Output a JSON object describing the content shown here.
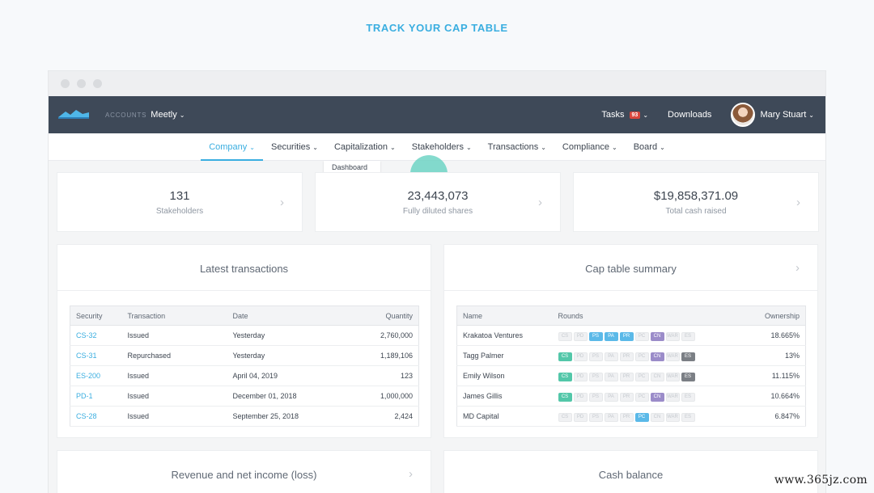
{
  "headline": "TRACK YOUR CAP TABLE",
  "topbar": {
    "accounts_label": "ACCOUNTS",
    "company": "Meetly",
    "tasks_label": "Tasks",
    "tasks_count": "93",
    "downloads": "Downloads",
    "user": "Mary Stuart"
  },
  "subnav": {
    "items": [
      "Company",
      "Securities",
      "Capitalization",
      "Stakeholders",
      "Transactions",
      "Compliance",
      "Board"
    ],
    "active": "Company",
    "dropdown_peek": "Dashboard"
  },
  "stats": [
    {
      "value": "131",
      "label": "Stakeholders"
    },
    {
      "value": "23,443,073",
      "label": "Fully diluted shares"
    },
    {
      "value": "$19,858,371.09",
      "label": "Total cash raised"
    }
  ],
  "latest": {
    "title": "Latest transactions",
    "columns": [
      "Security",
      "Transaction",
      "Date",
      "Quantity"
    ],
    "rows": [
      [
        "CS-32",
        "Issued",
        "Yesterday",
        "2,760,000"
      ],
      [
        "CS-31",
        "Repurchased",
        "Yesterday",
        "1,189,106"
      ],
      [
        "ES-200",
        "Issued",
        "April 04, 2019",
        "123"
      ],
      [
        "PD-1",
        "Issued",
        "December 01, 2018",
        "1,000,000"
      ],
      [
        "CS-28",
        "Issued",
        "September 25, 2018",
        "2,424"
      ]
    ]
  },
  "captable": {
    "title": "Cap table summary",
    "columns": [
      "Name",
      "Rounds",
      "Ownership"
    ],
    "round_codes": [
      "CS",
      "PD",
      "PS",
      "PA",
      "PR",
      "PC",
      "CN",
      "WAR",
      "ES"
    ],
    "rows": [
      {
        "name": "Krakatoa Ventures",
        "active": [
          "PS",
          "PA",
          "PR",
          "CN"
        ],
        "ownership": "18.665%"
      },
      {
        "name": "Tagg Palmer",
        "active": [
          "CS",
          "CN",
          "ES"
        ],
        "ownership": "13%"
      },
      {
        "name": "Emily Wilson",
        "active": [
          "CS",
          "ES"
        ],
        "ownership": "11.115%"
      },
      {
        "name": "James Gillis",
        "active": [
          "CS",
          "CN"
        ],
        "ownership": "10.664%"
      },
      {
        "name": "MD Capital",
        "active": [
          "PC"
        ],
        "ownership": "6.847%"
      }
    ]
  },
  "bottom_panels": [
    "Revenue and net income (loss)",
    "Cash balance"
  ],
  "watermark": "www.365jz.com",
  "colors": {
    "accent": "#3aaee0",
    "topbar": "#3e4958",
    "badge": "#d9463d",
    "cursor": "#5ccfbe"
  }
}
